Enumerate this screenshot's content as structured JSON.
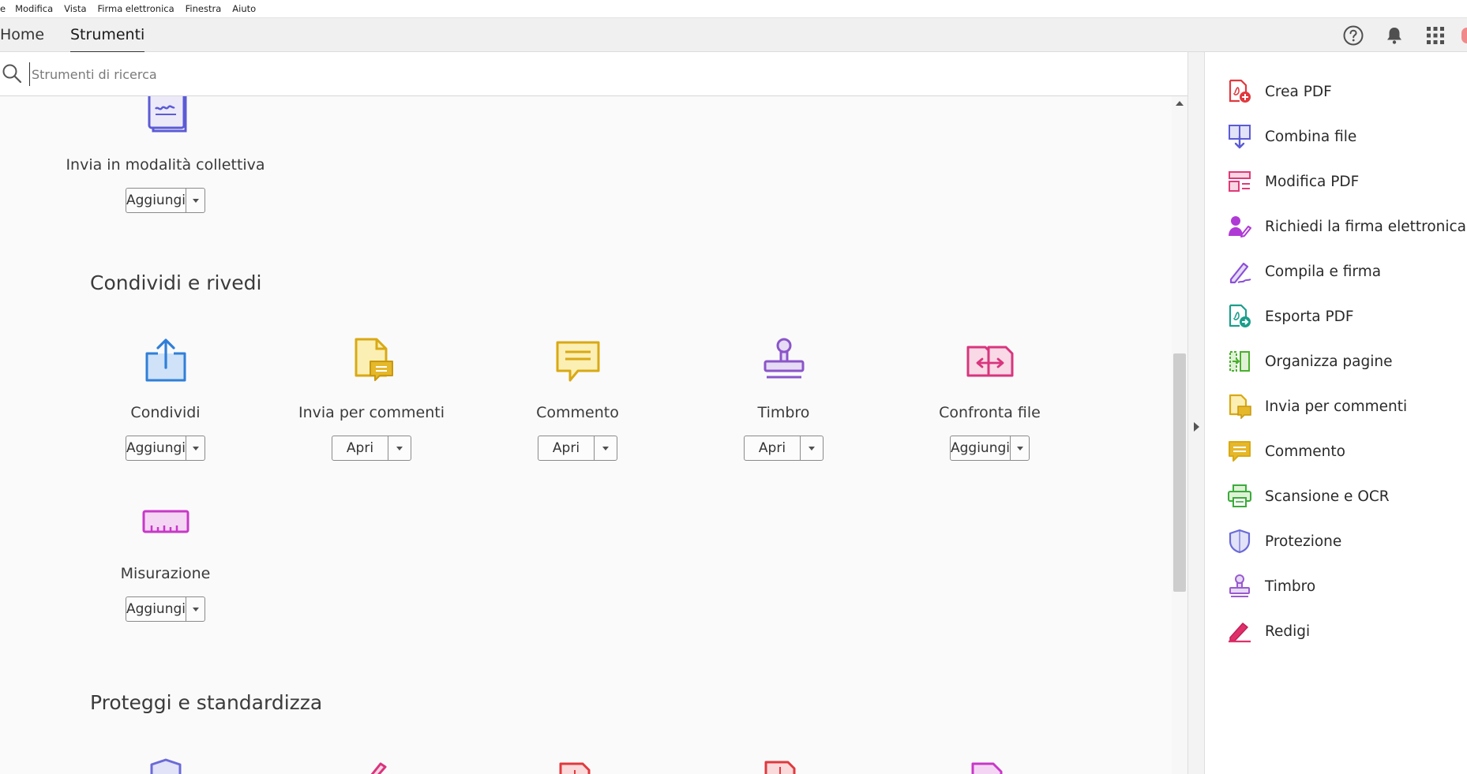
{
  "menubar": {
    "items": [
      "e",
      "Modifica",
      "Vista",
      "Firma elettronica",
      "Finestra",
      "Aiuto"
    ]
  },
  "tabs": {
    "home": "Home",
    "tools": "Strumenti"
  },
  "header_icons": [
    "help-icon",
    "bell-icon",
    "apps-grid-icon"
  ],
  "search": {
    "placeholder": "Strumenti di ricerca",
    "value": ""
  },
  "sections": [
    {
      "title": "Condividi e rivedi"
    },
    {
      "title": "Proteggi e standardizza"
    }
  ],
  "tools": {
    "collettiva": {
      "name": "Invia in modalità collettiva",
      "action": "Aggiungi",
      "icon": "send-bulk-icon"
    },
    "condividi": {
      "name": "Condividi",
      "action": "Aggiungi",
      "icon": "share-icon"
    },
    "invia_commenti": {
      "name": "Invia per commenti",
      "action": "Apri",
      "icon": "send-for-comments-icon"
    },
    "commento": {
      "name": "Commento",
      "action": "Apri",
      "icon": "comment-icon"
    },
    "timbro": {
      "name": "Timbro",
      "action": "Apri",
      "icon": "stamp-icon"
    },
    "confronta": {
      "name": "Confronta file",
      "action": "Aggiungi",
      "icon": "compare-files-icon"
    },
    "misurazione": {
      "name": "Misurazione",
      "action": "Aggiungi",
      "icon": "measure-icon"
    }
  },
  "right_panel": {
    "items": [
      {
        "label": "Crea PDF",
        "icon": "create-pdf-icon",
        "color": "#e0393e"
      },
      {
        "label": "Combina file",
        "icon": "combine-files-icon",
        "color": "#5b5bd6"
      },
      {
        "label": "Modifica PDF",
        "icon": "edit-pdf-icon",
        "color": "#e03a78"
      },
      {
        "label": "Richiedi la firma elettronica",
        "icon": "request-signature-icon",
        "color": "#b03ad6"
      },
      {
        "label": "Compila e firma",
        "icon": "fill-sign-icon",
        "color": "#8a4fd8"
      },
      {
        "label": "Esporta PDF",
        "icon": "export-pdf-icon",
        "color": "#1c9e8c"
      },
      {
        "label": "Organizza pagine",
        "icon": "organize-pages-icon",
        "color": "#4caf2f"
      },
      {
        "label": "Invia per commenti",
        "icon": "send-for-comments-icon",
        "color": "#e5b72a"
      },
      {
        "label": "Commento",
        "icon": "comment-icon",
        "color": "#e5b72a"
      },
      {
        "label": "Scansione e OCR",
        "icon": "scan-ocr-icon",
        "color": "#3bab3b"
      },
      {
        "label": "Protezione",
        "icon": "protect-icon",
        "color": "#6a6ad8"
      },
      {
        "label": "Timbro",
        "icon": "stamp-icon",
        "color": "#9a5ad0"
      },
      {
        "label": "Redigi",
        "icon": "redact-icon",
        "color": "#e0306a"
      }
    ]
  },
  "colors": {
    "accent_text": "#2c2c2c",
    "panel_bg": "#ffffff",
    "main_bg": "#fafafa"
  }
}
